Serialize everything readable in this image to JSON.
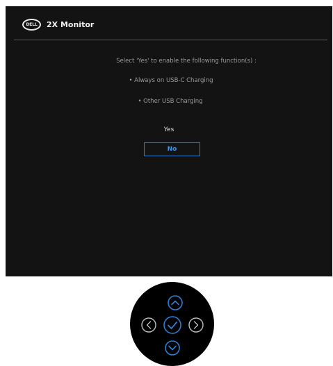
{
  "header": {
    "logo_text": "DELL",
    "title": "2X Monitor"
  },
  "message": {
    "main": "Select 'Yes' to enable the following function(s) :",
    "bullets": [
      "• Always on USB-C Charging",
      "• Other USB Charging"
    ]
  },
  "options": {
    "yes": "Yes",
    "no": "No",
    "selected": "No"
  },
  "joystick": {
    "buttons": [
      "up-icon",
      "left-icon",
      "confirm-icon",
      "right-icon",
      "down-icon"
    ]
  },
  "colors": {
    "osd_background": "#131313",
    "accent": "#2f78c4",
    "text_primary": "#f2f2f2",
    "text_secondary": "#9a9a9a"
  }
}
